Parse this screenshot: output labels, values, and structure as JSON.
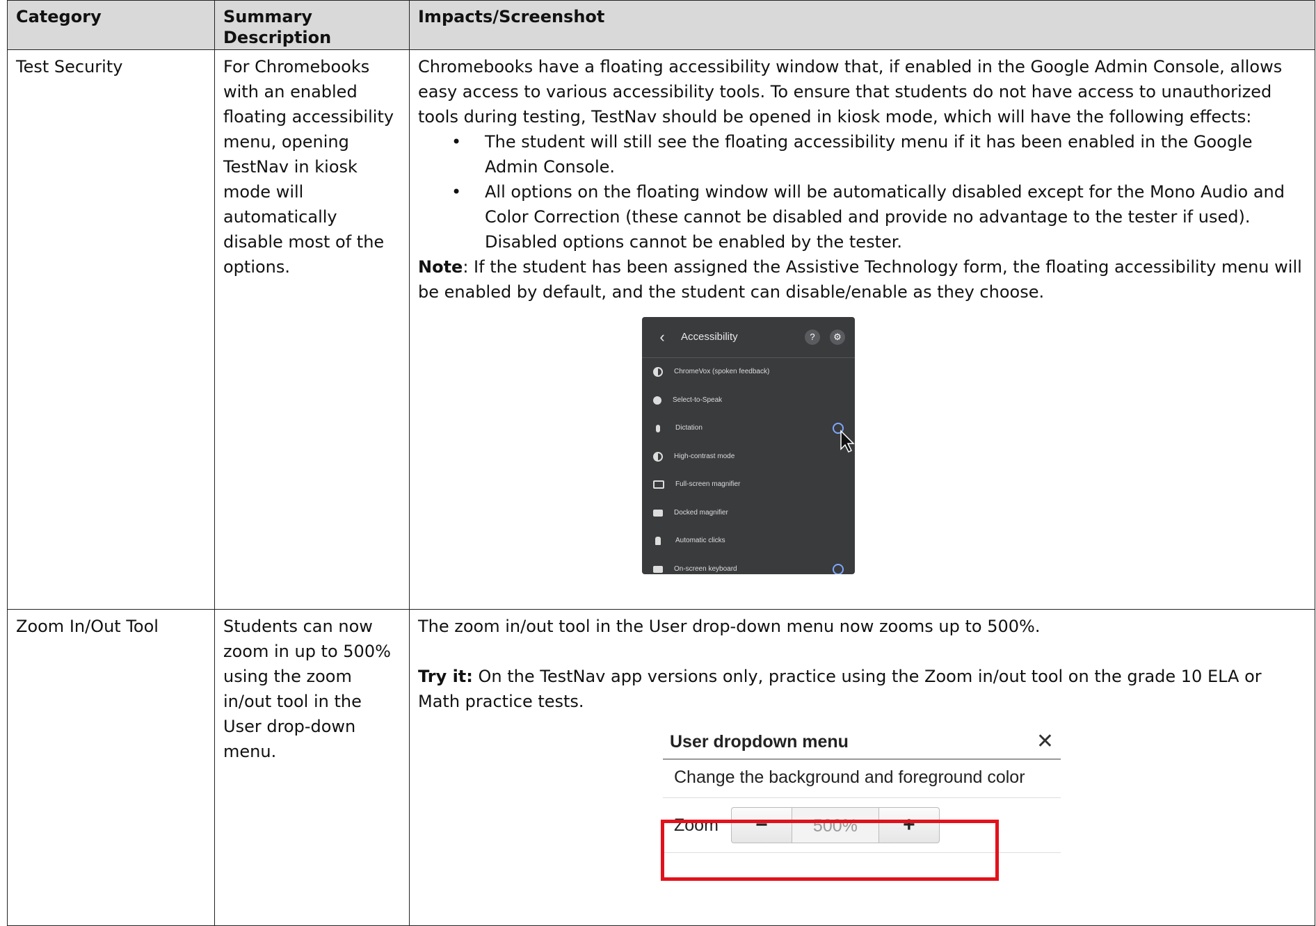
{
  "headers": {
    "category": "Category",
    "summary": "Summary Description",
    "impacts": "Impacts/Screenshot"
  },
  "rows": [
    {
      "category": "Test Security",
      "summary": "For Chromebooks with an enabled floating accessibility menu, opening TestNav in kiosk mode will automatically disable most of the options.",
      "intro": "Chromebooks have a floating accessibility window that, if enabled in the Google Admin Console, allows easy access to various accessibility tools. To ensure that students do not have access to unauthorized tools during testing, TestNav should be opened in kiosk mode, which will have the following effects:",
      "bullets": [
        "The student will still see the floating accessibility menu if it has been enabled in the Google Admin Console.",
        "All options on the floating window will be automatically disabled except for the Mono Audio and Color Correction (these cannot be disabled and provide no advantage to the tester if used). Disabled options cannot be enabled by the tester."
      ],
      "note_label": "Note",
      "note_text": ": If the student has been assigned the Assistive Technology form, the floating accessibility menu will be enabled by default, and the student can disable/enable as they choose.",
      "screenshot": {
        "title": "Accessibility",
        "back_icon": "chevron-left-icon",
        "items": [
          "ChromeVox (spoken feedback)",
          "Select-to-Speak",
          "Dictation",
          "High-contrast mode",
          "Full-screen magnifier",
          "Docked magnifier",
          "Automatic clicks",
          "On-screen keyboard"
        ]
      }
    },
    {
      "category": "Zoom In/Out Tool",
      "summary": "Students can now zoom in up to 500% using the zoom in/out tool in the User drop-down menu.",
      "intro": "The zoom in/out tool in the User drop-down menu now zooms up to 500%.",
      "try_label": "Try it:",
      "try_text": " On the TestNav app versions only, practice using the Zoom in/out tool on the grade 10 ELA or Math practice tests.",
      "screenshot": {
        "title": "User dropdown menu",
        "close": "✕",
        "row1": "Change the background and foreground color",
        "zoom_label": "Zoom",
        "minus": "−",
        "value": "500%",
        "plus": "+",
        "highlight_color": "#e2121c"
      }
    }
  ]
}
